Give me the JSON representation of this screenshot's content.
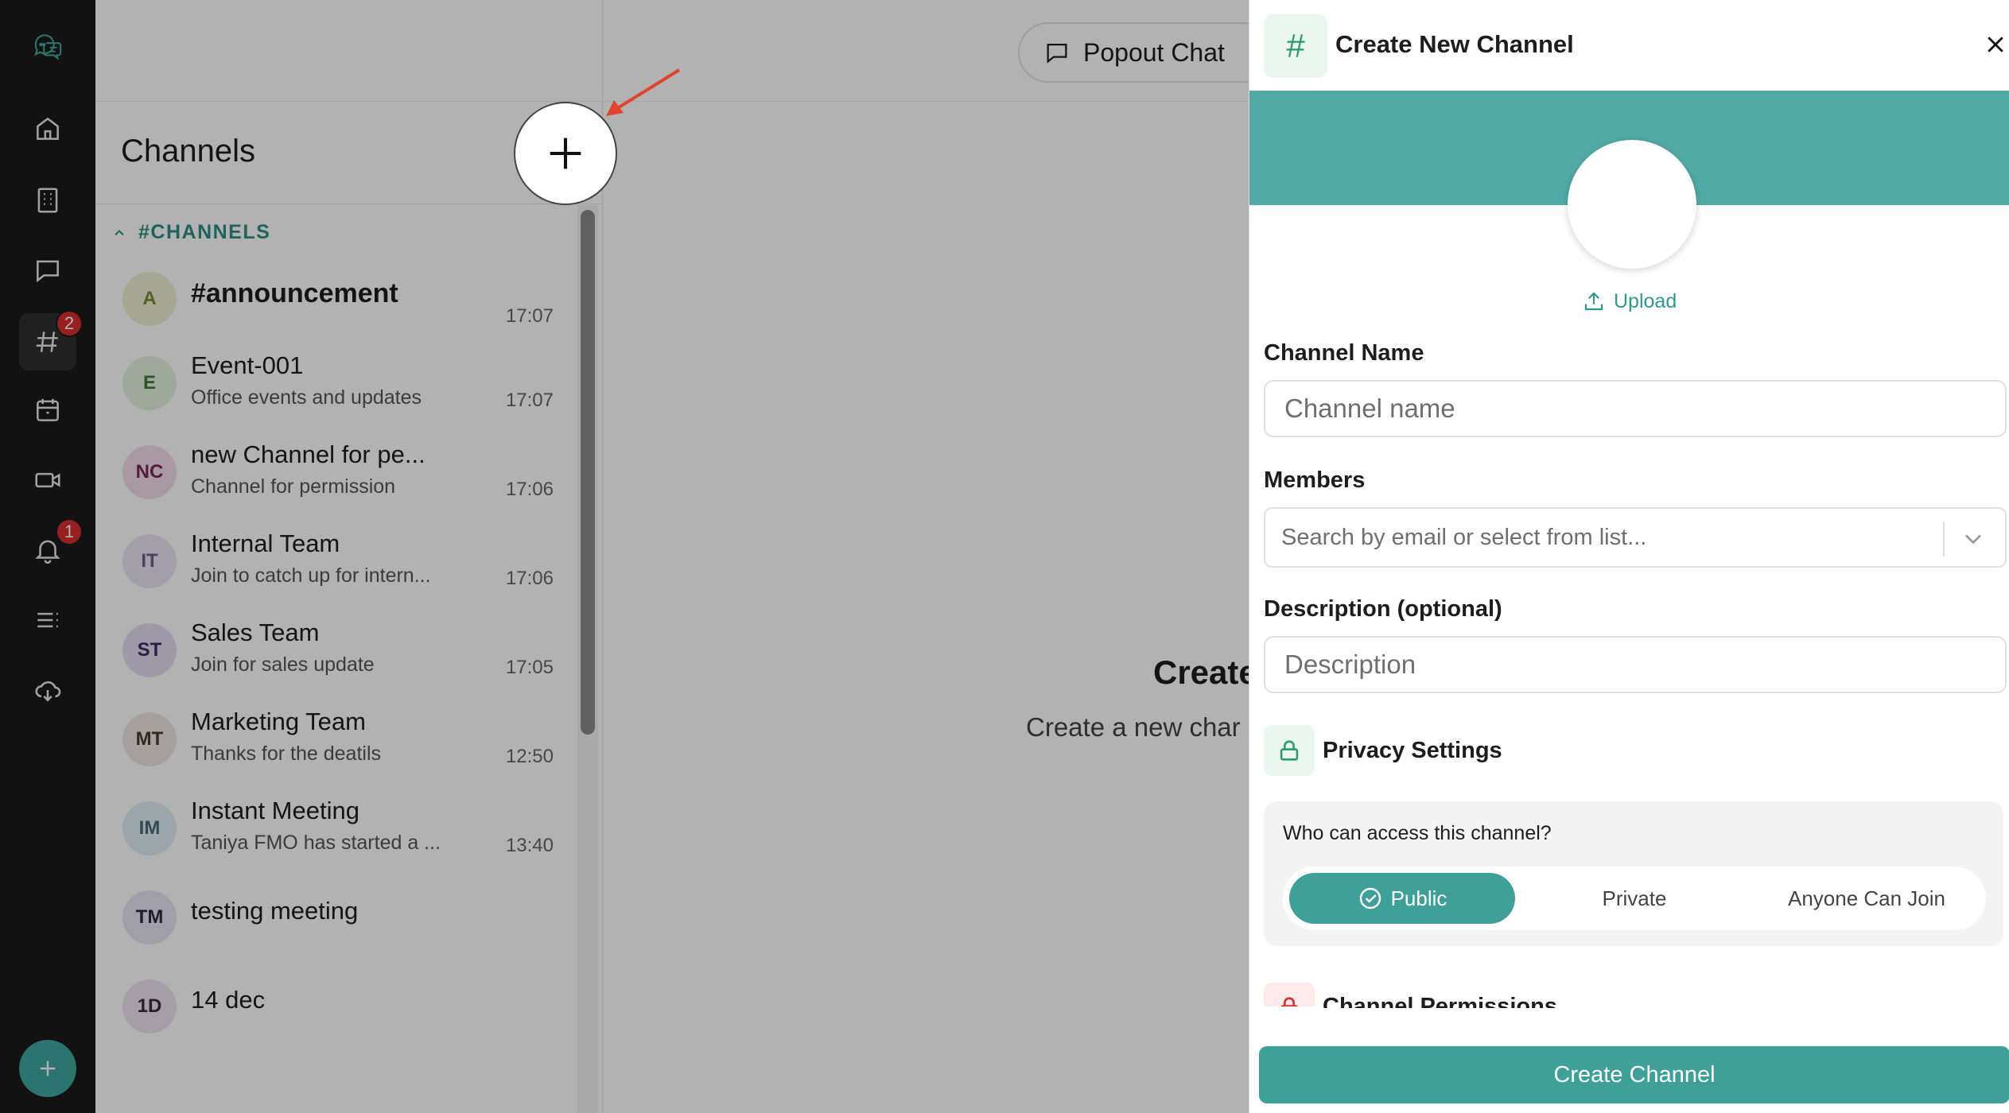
{
  "rail": {
    "badges": {
      "channels": "2",
      "notifications": "1"
    }
  },
  "channels_panel": {
    "title": "Channels",
    "section_label": "#CHANNELS",
    "items": [
      {
        "initials": "A",
        "name": "#announcement",
        "description": "",
        "time": "17:07",
        "bold": true
      },
      {
        "initials": "E",
        "name": "Event-001",
        "description": "Office events and updates",
        "time": "17:07"
      },
      {
        "initials": "NC",
        "name": "new Channel for pe...",
        "description": "Channel for permission",
        "time": "17:06"
      },
      {
        "initials": "IT",
        "name": "Internal Team",
        "description": "Join to catch up for intern...",
        "time": "17:06"
      },
      {
        "initials": "ST",
        "name": "Sales Team",
        "description": "Join for sales update",
        "time": "17:05"
      },
      {
        "initials": "MT",
        "name": "Marketing Team",
        "description": "Thanks for the deatils",
        "time": "12:50"
      },
      {
        "initials": "IM",
        "name": "Instant Meeting",
        "description": "Taniya FMO has started a ...",
        "time": "13:40"
      },
      {
        "initials": "TM",
        "name": "testing meeting",
        "description": "",
        "time": ""
      },
      {
        "initials": "1D",
        "name": "14 dec",
        "description": "",
        "time": ""
      }
    ]
  },
  "main": {
    "popout_label": "Popout Chat",
    "empty_title": "Create",
    "empty_subtitle": "Create a new char"
  },
  "drawer": {
    "title": "Create New Channel",
    "upload_label": "Upload",
    "channel_name_label": "Channel Name",
    "channel_name_placeholder": "Channel name",
    "members_label": "Members",
    "members_placeholder": "Search by email or select from list...",
    "description_label": "Description (optional)",
    "description_placeholder": "Description",
    "privacy_title": "Privacy Settings",
    "privacy_question": "Who can access this channel?",
    "privacy_options": [
      "Public",
      "Private",
      "Anyone Can Join"
    ],
    "privacy_selected": "Public",
    "permissions_title": "Channel Permissions",
    "create_button": "Create Channel"
  },
  "colors": {
    "accent": "#3f9f99",
    "banner": "#52aaa7",
    "rail_bg": "#1a1a1b",
    "badge": "#d92d2d"
  }
}
